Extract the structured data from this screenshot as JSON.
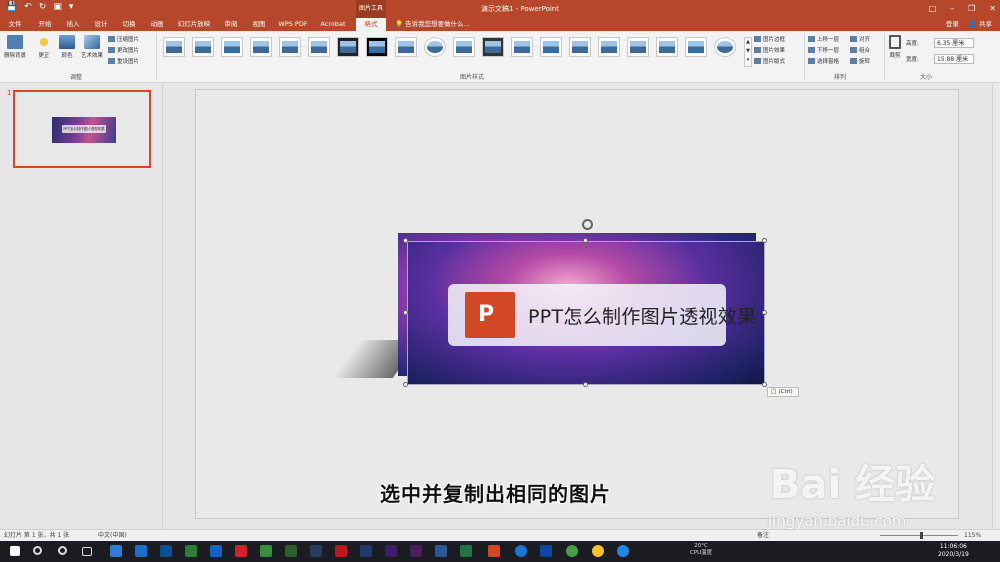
{
  "title_bar": {
    "context_tool": "图片工具",
    "document_title": "演示文稿1 - PowerPoint"
  },
  "tabs": [
    {
      "label": "文件"
    },
    {
      "label": "开始"
    },
    {
      "label": "插入"
    },
    {
      "label": "设计"
    },
    {
      "label": "切换"
    },
    {
      "label": "动画"
    },
    {
      "label": "幻灯片放映"
    },
    {
      "label": "审阅"
    },
    {
      "label": "视图"
    },
    {
      "label": "WPS PDF"
    },
    {
      "label": "Acrobat"
    },
    {
      "label": "格式"
    }
  ],
  "tell_me": "告诉我您想要做什么...",
  "account": {
    "login": "登录",
    "share": "共享"
  },
  "ribbon": {
    "remove_bg": "删除背景",
    "corrections": "更正",
    "color": "颜色",
    "artistic": "艺术效果",
    "compress": "压缩图片",
    "change": "更改图片",
    "reset": "重设图片",
    "group_adjust": "调整",
    "group_styles": "图片样式",
    "picture_border": "图片边框",
    "picture_effects": "图片效果",
    "picture_layout": "图片版式",
    "bring_forward": "上移一层",
    "send_backward": "下移一层",
    "selection_pane": "选择窗格",
    "align": "对齐",
    "group": "组合",
    "rotate": "旋转",
    "group_arrange": "排列",
    "crop": "裁剪",
    "height_label": "高度:",
    "height_value": "6.35 厘米",
    "width_label": "宽度:",
    "width_value": "15.88 厘米",
    "group_size": "大小"
  },
  "slides": [
    {
      "number": "1",
      "title_text": "PPT怎么制作图片透视效果"
    }
  ],
  "slide": {
    "banner_text": "PPT怎么制作图片透视效果",
    "ppt_logo_letter": "P",
    "paste_tag": "(Ctrl)",
    "caption": "选中并复制出相同的图片"
  },
  "watermark": {
    "line1": "Bai 经验",
    "line2": "jingyan.baidu.com"
  },
  "status_bar": {
    "slide_info": "幻灯片 第 1 张，共 1 张",
    "language": "中文(中国)",
    "notes": "备注",
    "zoom": "115%"
  },
  "taskbar": {
    "temperature": "20°C",
    "cpu_label": "CPU温度",
    "time": "11:06:06",
    "date": "2020/3/19"
  },
  "colors": {
    "accent": "#b7472a",
    "selected_thumb_border": "#d24726",
    "taskbar": "#1b1b22"
  }
}
